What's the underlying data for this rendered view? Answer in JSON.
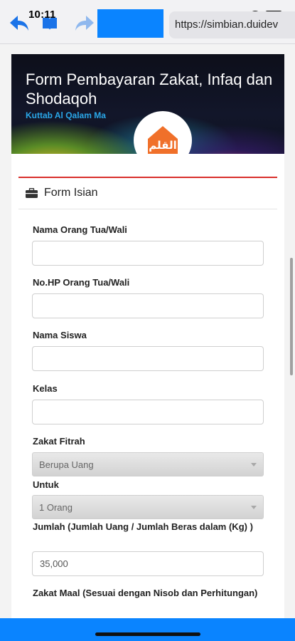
{
  "status_bar": {
    "time": "10:11"
  },
  "browser": {
    "url": "https://simbian.duidev",
    "accent_color": "#0a84ff",
    "back_icon": "back-arrow-icon",
    "bookmarks_icon": "book-icon",
    "forward_icon": "forward-arrow-icon"
  },
  "banner": {
    "title": "Form Pembayaran Zakat, Infaq dan Shodaqoh",
    "subtitle": "Kuttab Al Qalam Ma",
    "logo_text": "القلم",
    "logo_color": "#f0702a"
  },
  "form": {
    "header_title": "Form Isian",
    "header_icon": "briefcase-icon",
    "accent_rule_color": "#d9302b",
    "fields": {
      "nama_ortu": {
        "label": "Nama Orang Tua/Wali",
        "value": ""
      },
      "hp_ortu": {
        "label": "No.HP Orang Tua/Wali",
        "value": ""
      },
      "nama_siswa": {
        "label": "Nama Siswa",
        "value": ""
      },
      "kelas": {
        "label": "Kelas",
        "value": ""
      },
      "zakat_fitrah": {
        "label": "Zakat Fitrah",
        "selected": "Berupa Uang"
      },
      "untuk": {
        "label": "Untuk",
        "selected": "1 Orang"
      },
      "jumlah": {
        "label": "Jumlah (Jumlah Uang / Jumlah Beras dalam (Kg) )",
        "value": "35,000"
      },
      "zakat_maal": {
        "label": "Zakat Maal (Sesuai dengan Nisob dan Perhitungan)"
      }
    }
  }
}
